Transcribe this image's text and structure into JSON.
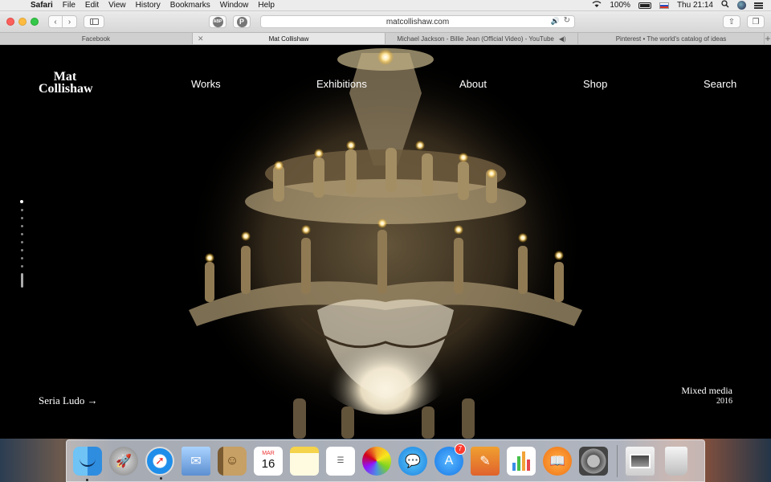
{
  "menubar": {
    "app_name": "Safari",
    "menus": [
      "File",
      "Edit",
      "View",
      "History",
      "Bookmarks",
      "Window",
      "Help"
    ],
    "battery": "100%",
    "clock": "Thu 21:14"
  },
  "toolbar": {
    "url": "matcollishaw.com",
    "extensions": [
      "ABP",
      "P"
    ]
  },
  "tabs": [
    {
      "title": "Facebook",
      "active": false
    },
    {
      "title": "Mat Collishaw",
      "active": true
    },
    {
      "title": "Michael Jackson - Billie Jean (Official Video) - YouTube",
      "active": false,
      "audio": true
    },
    {
      "title": "Pinterest • The world's catalog of ideas",
      "active": false
    }
  ],
  "site": {
    "logo_line1": "Mat",
    "logo_line2": "Collishaw",
    "nav": [
      "Works",
      "Exhibitions",
      "About",
      "Shop",
      "Search"
    ],
    "slide_count": 10,
    "active_slide": 1,
    "caption_title": "Seria Ludo →",
    "medium": "Mixed media",
    "year": "2016"
  },
  "dock": {
    "calendar_month": "MAR",
    "calendar_day": "16",
    "appstore_badge": "7"
  },
  "colors": {
    "site_background": "#000000",
    "accent_blue": "#2b7bf0"
  }
}
